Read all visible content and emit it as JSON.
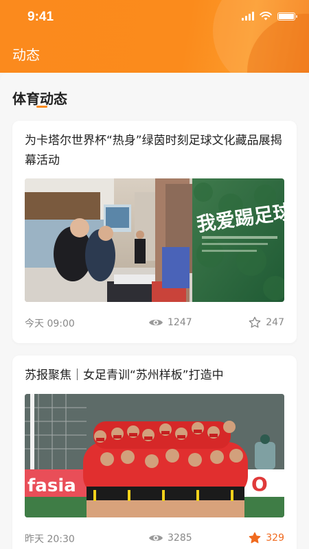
{
  "status_bar": {
    "time": "9:41"
  },
  "header": {
    "title": "动态"
  },
  "section": {
    "title": "体育动态"
  },
  "colors": {
    "accent": "#fb8a1d",
    "liked": "#f06a1f"
  },
  "articles": [
    {
      "title": "为卡塔尔世界杯“热身”绿茵时刻足球文化藏品展揭幕活动",
      "image_sign_text": "我爱踢足球",
      "time": "今天 09:00",
      "views": "1247",
      "likes": "247",
      "liked": false
    },
    {
      "title": "苏报聚焦｜女足青训“苏州样板”打造中",
      "image_banner_text": "fasia",
      "time": "昨天 20:30",
      "views": "3285",
      "likes": "329",
      "liked": true
    }
  ],
  "icons": {
    "views": "eye-icon",
    "likes": "star-icon"
  }
}
